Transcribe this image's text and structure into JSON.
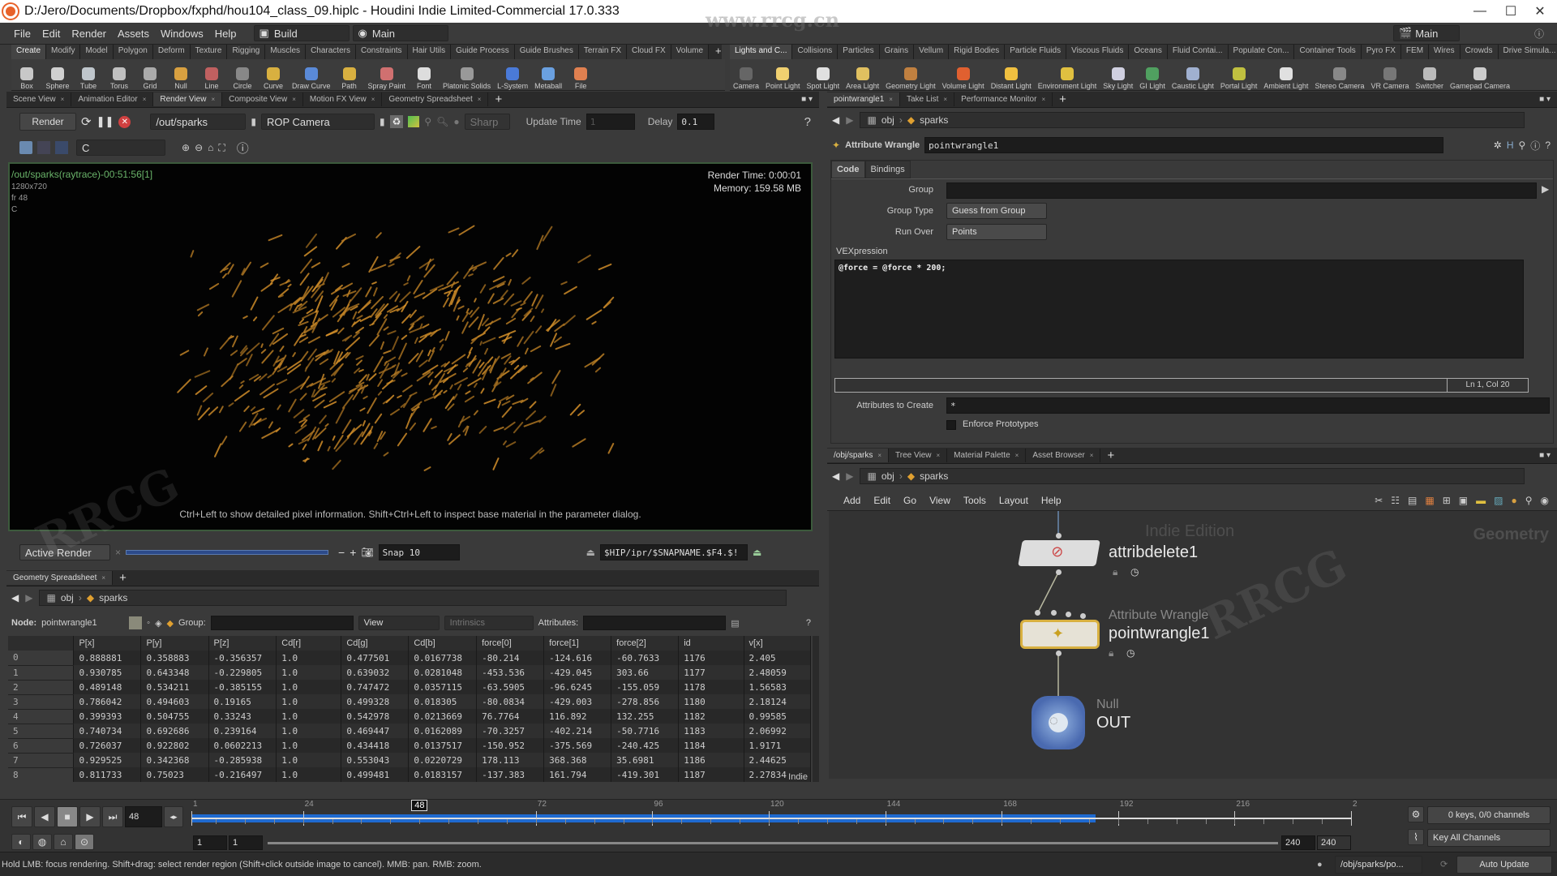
{
  "window": {
    "title": "D:/Jero/Documents/Dropbox/fxphd/hou104_class_09.hiplc - Houdini Indie Limited-Commercial 17.0.333",
    "controls": [
      "minimize",
      "maximize",
      "close"
    ]
  },
  "menubar": {
    "items": [
      "File",
      "Edit",
      "Render",
      "Assets",
      "Windows",
      "Help"
    ],
    "desktop_label": "Build",
    "context_label": "Main",
    "right_context": "Main"
  },
  "shelf_left": {
    "tabs": [
      "Create",
      "Modify",
      "Model",
      "Polygon",
      "Deform",
      "Texture",
      "Rigging",
      "Muscles",
      "Characters",
      "Constraints",
      "Hair Utils",
      "Guide Process",
      "Guide Brushes",
      "Terrain FX",
      "Cloud FX",
      "Volume"
    ],
    "active_tab": "Create",
    "tools": [
      {
        "label": "Box",
        "icon": "box-icon",
        "color": "#c8c8c8"
      },
      {
        "label": "Sphere",
        "icon": "sphere-icon",
        "color": "#d0d0d0"
      },
      {
        "label": "Tube",
        "icon": "tube-icon",
        "color": "#bfc6cc"
      },
      {
        "label": "Torus",
        "icon": "torus-icon",
        "color": "#c0c0c0"
      },
      {
        "label": "Grid",
        "icon": "grid-icon",
        "color": "#aaaaaa"
      },
      {
        "label": "Null",
        "icon": "null-icon",
        "color": "#d8a040"
      },
      {
        "label": "Line",
        "icon": "line-icon",
        "color": "#c06060"
      },
      {
        "label": "Circle",
        "icon": "circle-icon",
        "color": "#888888"
      },
      {
        "label": "Curve",
        "icon": "curve-icon",
        "color": "#d8b040"
      },
      {
        "label": "Draw Curve",
        "icon": "draw-curve-icon",
        "color": "#5a8ad8"
      },
      {
        "label": "Path",
        "icon": "path-icon",
        "color": "#d8b040"
      },
      {
        "label": "Spray Paint",
        "icon": "spray-paint-icon",
        "color": "#d07070"
      },
      {
        "label": "Font",
        "icon": "font-icon",
        "color": "#dddddd"
      },
      {
        "label": "Platonic Solids",
        "icon": "platonic-solids-icon",
        "color": "#999999"
      },
      {
        "label": "L-System",
        "icon": "l-system-icon",
        "color": "#4a7ad8"
      },
      {
        "label": "Metaball",
        "icon": "metaball-icon",
        "color": "#6aa0e0"
      },
      {
        "label": "File",
        "icon": "file-icon",
        "color": "#e08050"
      }
    ]
  },
  "shelf_right": {
    "tabs": [
      "Lights and C...",
      "Collisions",
      "Particles",
      "Grains",
      "Vellum",
      "Rigid Bodies",
      "Particle Fluids",
      "Viscous Fluids",
      "Oceans",
      "Fluid Contai...",
      "Populate Con...",
      "Container Tools",
      "Pyro FX",
      "FEM",
      "Wires",
      "Crowds",
      "Drive Simula..."
    ],
    "active_tab": "Lights and C...",
    "tools": [
      {
        "label": "Camera",
        "icon": "camera-icon",
        "color": "#666666"
      },
      {
        "label": "Point Light",
        "icon": "point-light-icon",
        "color": "#f0d070"
      },
      {
        "label": "Spot Light",
        "icon": "spot-light-icon",
        "color": "#e0e0e0"
      },
      {
        "label": "Area Light",
        "icon": "area-light-icon",
        "color": "#e0c060"
      },
      {
        "label": "Geometry Light",
        "icon": "geometry-light-icon",
        "color": "#c08040"
      },
      {
        "label": "Volume Light",
        "icon": "volume-light-icon",
        "color": "#e06030"
      },
      {
        "label": "Distant Light",
        "icon": "distant-light-icon",
        "color": "#f0c040"
      },
      {
        "label": "Environment Light",
        "icon": "environment-light-icon",
        "color": "#e0c040"
      },
      {
        "label": "Sky Light",
        "icon": "sky-light-icon",
        "color": "#d0d0e0"
      },
      {
        "label": "GI Light",
        "icon": "gi-light-icon",
        "color": "#50a060"
      },
      {
        "label": "Caustic Light",
        "icon": "caustic-light-icon",
        "color": "#a0b0d0"
      },
      {
        "label": "Portal Light",
        "icon": "portal-light-icon",
        "color": "#c0c040"
      },
      {
        "label": "Ambient Light",
        "icon": "ambient-light-icon",
        "color": "#e0e0e0"
      },
      {
        "label": "Stereo Camera",
        "icon": "stereo-camera-icon",
        "color": "#888888"
      },
      {
        "label": "VR Camera",
        "icon": "vr-camera-icon",
        "color": "#777777"
      },
      {
        "label": "Switcher",
        "icon": "switcher-icon",
        "color": "#bbbbbb"
      },
      {
        "label": "Gamepad Camera",
        "icon": "gamepad-camera-icon",
        "color": "#cccccc"
      }
    ]
  },
  "left_pane": {
    "tabs": [
      "Scene View",
      "Animation Editor",
      "Render View",
      "Composite View",
      "Motion FX View",
      "Geometry Spreadsheet"
    ],
    "active_tab": "Render View",
    "render_toolbar": {
      "render_button": "Render",
      "rop_path": "/out/sparks",
      "camera": "ROP Camera",
      "sharp_label": "Sharp",
      "update_time_label": "Update Time",
      "update_time_value": "1",
      "delay_label": "Delay",
      "delay_value": "0.1",
      "channel": "C"
    },
    "render_info": {
      "rop_line": "/out/sparks(raytrace)-00:51:56[1]",
      "resolution": "1280x720",
      "frame": "fr 48",
      "channel": "C",
      "render_time": "Render Time: 0:00:01",
      "memory": "Memory:   159.58 MB",
      "hint": "Ctrl+Left to show detailed pixel information. Shift+Ctrl+Left to inspect base material in the parameter dialog."
    },
    "snapshot_bar": {
      "mode": "Active Render",
      "snap_label": "Snap 10",
      "snap_path": "$HIP/ipr/$SNAPNAME.$F4.$!"
    }
  },
  "spreadsheet": {
    "tab": "Geometry Spreadsheet",
    "path": [
      "obj",
      "sparks"
    ],
    "node_label": "Node:",
    "node_name": "pointwrangle1",
    "group_label": "Group:",
    "view_label": "View",
    "intrinsics_label": "Intrinsics",
    "attributes_label": "Attributes:",
    "columns": [
      "P[x]",
      "P[y]",
      "P[z]",
      "Cd[r]",
      "Cd[g]",
      "Cd[b]",
      "force[0]",
      "force[1]",
      "force[2]",
      "id",
      "v[x]"
    ],
    "rows": [
      [
        "0",
        "0.888881",
        "0.358883",
        "-0.356357",
        "1.0",
        "0.477501",
        "0.0167738",
        "-80.214",
        "-124.616",
        "-60.7633",
        "1176",
        "2.405"
      ],
      [
        "1",
        "0.930785",
        "0.643348",
        "-0.229805",
        "1.0",
        "0.639032",
        "0.0281048",
        "-453.536",
        "-429.045",
        "303.66",
        "1177",
        "2.48059"
      ],
      [
        "2",
        "0.489148",
        "0.534211",
        "-0.385155",
        "1.0",
        "0.747472",
        "0.0357115",
        "-63.5905",
        "-96.6245",
        "-155.059",
        "1178",
        "1.56583"
      ],
      [
        "3",
        "0.786042",
        "0.494603",
        "0.19165",
        "1.0",
        "0.499328",
        "0.018305",
        "-80.0834",
        "-429.003",
        "-278.856",
        "1180",
        "2.18124"
      ],
      [
        "4",
        "0.399393",
        "0.504755",
        "0.33243",
        "1.0",
        "0.542978",
        "0.0213669",
        "76.7764",
        "116.892",
        "132.255",
        "1182",
        "0.99585"
      ],
      [
        "5",
        "0.740734",
        "0.692686",
        "0.239164",
        "1.0",
        "0.469447",
        "0.0162089",
        "-70.3257",
        "-402.214",
        "-50.7716",
        "1183",
        "2.06992"
      ],
      [
        "6",
        "0.726037",
        "0.922802",
        "0.0602213",
        "1.0",
        "0.434418",
        "0.0137517",
        "-150.952",
        "-375.569",
        "-240.425",
        "1184",
        "1.9171"
      ],
      [
        "7",
        "0.929525",
        "0.342368",
        "-0.285938",
        "1.0",
        "0.553043",
        "0.0220729",
        "178.113",
        "368.368",
        "35.6981",
        "1186",
        "2.44625"
      ],
      [
        "8",
        "0.811733",
        "0.75023",
        "-0.216497",
        "1.0",
        "0.499481",
        "0.0183157",
        "-137.383",
        "161.794",
        "-419.301",
        "1187",
        "2.27834"
      ]
    ],
    "indie_badge": "Indie"
  },
  "params_pane": {
    "tabs": [
      "pointwrangle1",
      "Take List",
      "Performance Monitor"
    ],
    "path": [
      "obj",
      "sparks"
    ],
    "node_type": "Attribute Wrangle",
    "node_name": "pointwrangle1",
    "subtabs": [
      "Code",
      "Bindings"
    ],
    "active_subtab": "Code",
    "group_label": "Group",
    "group_value": "",
    "group_type_label": "Group Type",
    "group_type_value": "Guess from Group",
    "run_over_label": "Run Over",
    "run_over_value": "Points",
    "vex_label": "VEXpression",
    "vex_code": "@force = @force * 200;",
    "cursor_pos": "Ln 1, Col 20",
    "attrs_create_label": "Attributes to Create",
    "attrs_create_value": "*",
    "enforce_label": "Enforce Prototypes",
    "enforce_checked": false
  },
  "network_pane": {
    "tabs": [
      "/obj/sparks",
      "Tree View",
      "Material Palette",
      "Asset Browser"
    ],
    "path": [
      "obj",
      "sparks"
    ],
    "menu": [
      "Add",
      "Edit",
      "Go",
      "View",
      "Tools",
      "Layout",
      "Help"
    ],
    "watermark_edition": "Indie Edition",
    "watermark_context": "Geometry",
    "nodes": [
      {
        "name": "attribdelete1",
        "type": "",
        "icon": "attribdelete-icon"
      },
      {
        "name": "pointwrangle1",
        "type": "Attribute Wrangle",
        "icon": "wrangle-icon",
        "selected": true
      },
      {
        "name": "OUT",
        "type": "Null",
        "icon": "null-node-icon"
      }
    ]
  },
  "timeline": {
    "current_frame": "48",
    "ticks": [
      "1",
      "24",
      "48",
      "72",
      "96",
      "120",
      "144",
      "168",
      "192",
      "216",
      "2"
    ],
    "cached_fraction": 0.78,
    "range_start": "1",
    "range_start2": "1",
    "range_end": "240",
    "range_end2": "240",
    "keys_label": "0 keys, 0/0 channels",
    "key_all_label": "Key All Channels"
  },
  "status_bar": {
    "message": "Hold LMB: focus rendering. Shift+drag: select render region (Shift+click outside image to cancel). MMB: pan. RMB: zoom.",
    "path": "/obj/sparks/po...",
    "update_mode": "Auto Update"
  }
}
